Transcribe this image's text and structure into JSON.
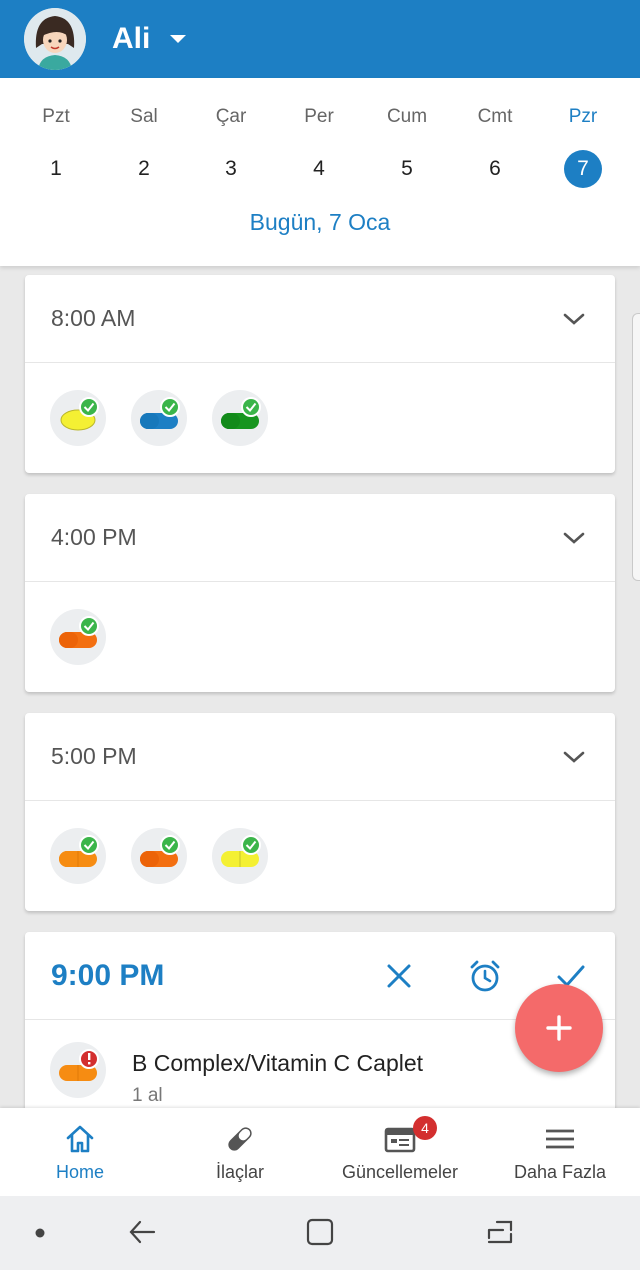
{
  "header": {
    "user_name": "Ali"
  },
  "week": {
    "days": [
      {
        "name": "Pzt",
        "num": "1"
      },
      {
        "name": "Sal",
        "num": "2"
      },
      {
        "name": "Çar",
        "num": "3"
      },
      {
        "name": "Per",
        "num": "4"
      },
      {
        "name": "Cum",
        "num": "5"
      },
      {
        "name": "Cmt",
        "num": "6"
      },
      {
        "name": "Pzr",
        "num": "7"
      }
    ],
    "today_label": "Bugün, 7 Oca"
  },
  "schedule": [
    {
      "time": "8:00 AM",
      "pills": [
        {
          "color": "#f4f033",
          "status": "taken"
        },
        {
          "color": "#1d7fc4",
          "status": "taken"
        },
        {
          "color": "#17951f",
          "status": "taken"
        }
      ]
    },
    {
      "time": "4:00 PM",
      "pills": [
        {
          "color": "#f36f10",
          "status": "taken"
        }
      ]
    },
    {
      "time": "5:00 PM",
      "pills": [
        {
          "color": "#f68c12",
          "status": "taken"
        },
        {
          "color": "#f36f10",
          "status": "taken"
        },
        {
          "color": "#f4f033",
          "status": "taken"
        }
      ]
    }
  ],
  "active": {
    "time": "9:00 PM",
    "med_name": "B Complex/Vitamin C Caplet",
    "med_dose": "1 al",
    "pill_color": "#f68c12",
    "status": "missed"
  },
  "nav": {
    "items": [
      {
        "label": "Home",
        "icon": "home-icon"
      },
      {
        "label": "İlaçlar",
        "icon": "pill-icon"
      },
      {
        "label": "Güncellemeler",
        "icon": "calendar-icon",
        "badge": "4"
      },
      {
        "label": "Daha Fazla",
        "icon": "menu-icon"
      }
    ]
  },
  "colors": {
    "primary": "#1d7fc4",
    "check": "#3bb54a",
    "alert": "#d32f2f",
    "fab": "#f46a6a"
  }
}
